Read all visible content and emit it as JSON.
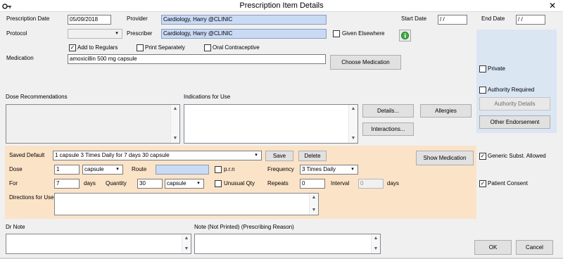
{
  "window": {
    "title": "Prescription Item Details",
    "close": "✕"
  },
  "header": {
    "prescription_date_label": "Prescription Date",
    "prescription_date": "05/09/2018",
    "provider_label": "Provider",
    "provider": "Cardiology, Harry @CLINIC",
    "start_date_label": "Start Date",
    "start_date": "/ /",
    "end_date_label": "End Date",
    "end_date": "/ /",
    "protocol_label": "Protocol",
    "protocol": "",
    "prescriber_label": "Prescriber",
    "prescriber": "Cardiology, Harry @CLINIC",
    "given_elsewhere_label": "Given Elsewhere",
    "add_to_regulars_label": "Add to Regulars",
    "add_to_regulars": true,
    "print_separately_label": "Print Separately",
    "print_separately": false,
    "oral_contraceptive_label": "Oral Contraceptive",
    "oral_contraceptive": false
  },
  "medication": {
    "label": "Medication",
    "value": "amoxicillin 500 mg capsule",
    "choose_button": "Choose Medication"
  },
  "right_panel": {
    "private_label": "Private",
    "authority_required_label": "Authority Required",
    "authority_details_button": "Authority Details",
    "other_endorsement_button": "Other Endorsement",
    "generic_subst_label": "Generic Subst. Allowed",
    "generic_subst": true,
    "patient_consent_label": "Patient Consent",
    "patient_consent": true
  },
  "dose_recommendations_label": "Dose Recommendations",
  "indications_label": "Indications  for Use",
  "buttons": {
    "details": "Details...",
    "allergies": "Allergies",
    "interactions": "Interactions...",
    "show_medication": "Show Medication",
    "ok": "OK",
    "cancel": "Cancel"
  },
  "orange": {
    "saved_default_label": "Saved Default",
    "saved_default": "1 capsule 3 Times Daily for 7 days 30 capsule",
    "save_button": "Save",
    "delete_button": "Delete",
    "dose_label": "Dose",
    "dose": "1",
    "dose_unit": "capsule",
    "route_label": "Route",
    "prn_label": "p.r.n",
    "frequency_label": "Frequency",
    "frequency": "3 Times Daily",
    "for_label": "For",
    "for_value": "7",
    "days_label": "days",
    "quantity_label": "Quantity",
    "quantity": "30",
    "quantity_unit": "capsule",
    "unusual_qty_label": "Unusual Qty",
    "repeats_label": "Repeats",
    "repeats": "0",
    "interval_label": "Interval",
    "interval": "0",
    "interval_days_label": "days",
    "directions_label": "Directions for Use"
  },
  "dr_note_label": "Dr Note",
  "note_not_printed_label": "Note (Not Printed) (Prescribing Reason)"
}
